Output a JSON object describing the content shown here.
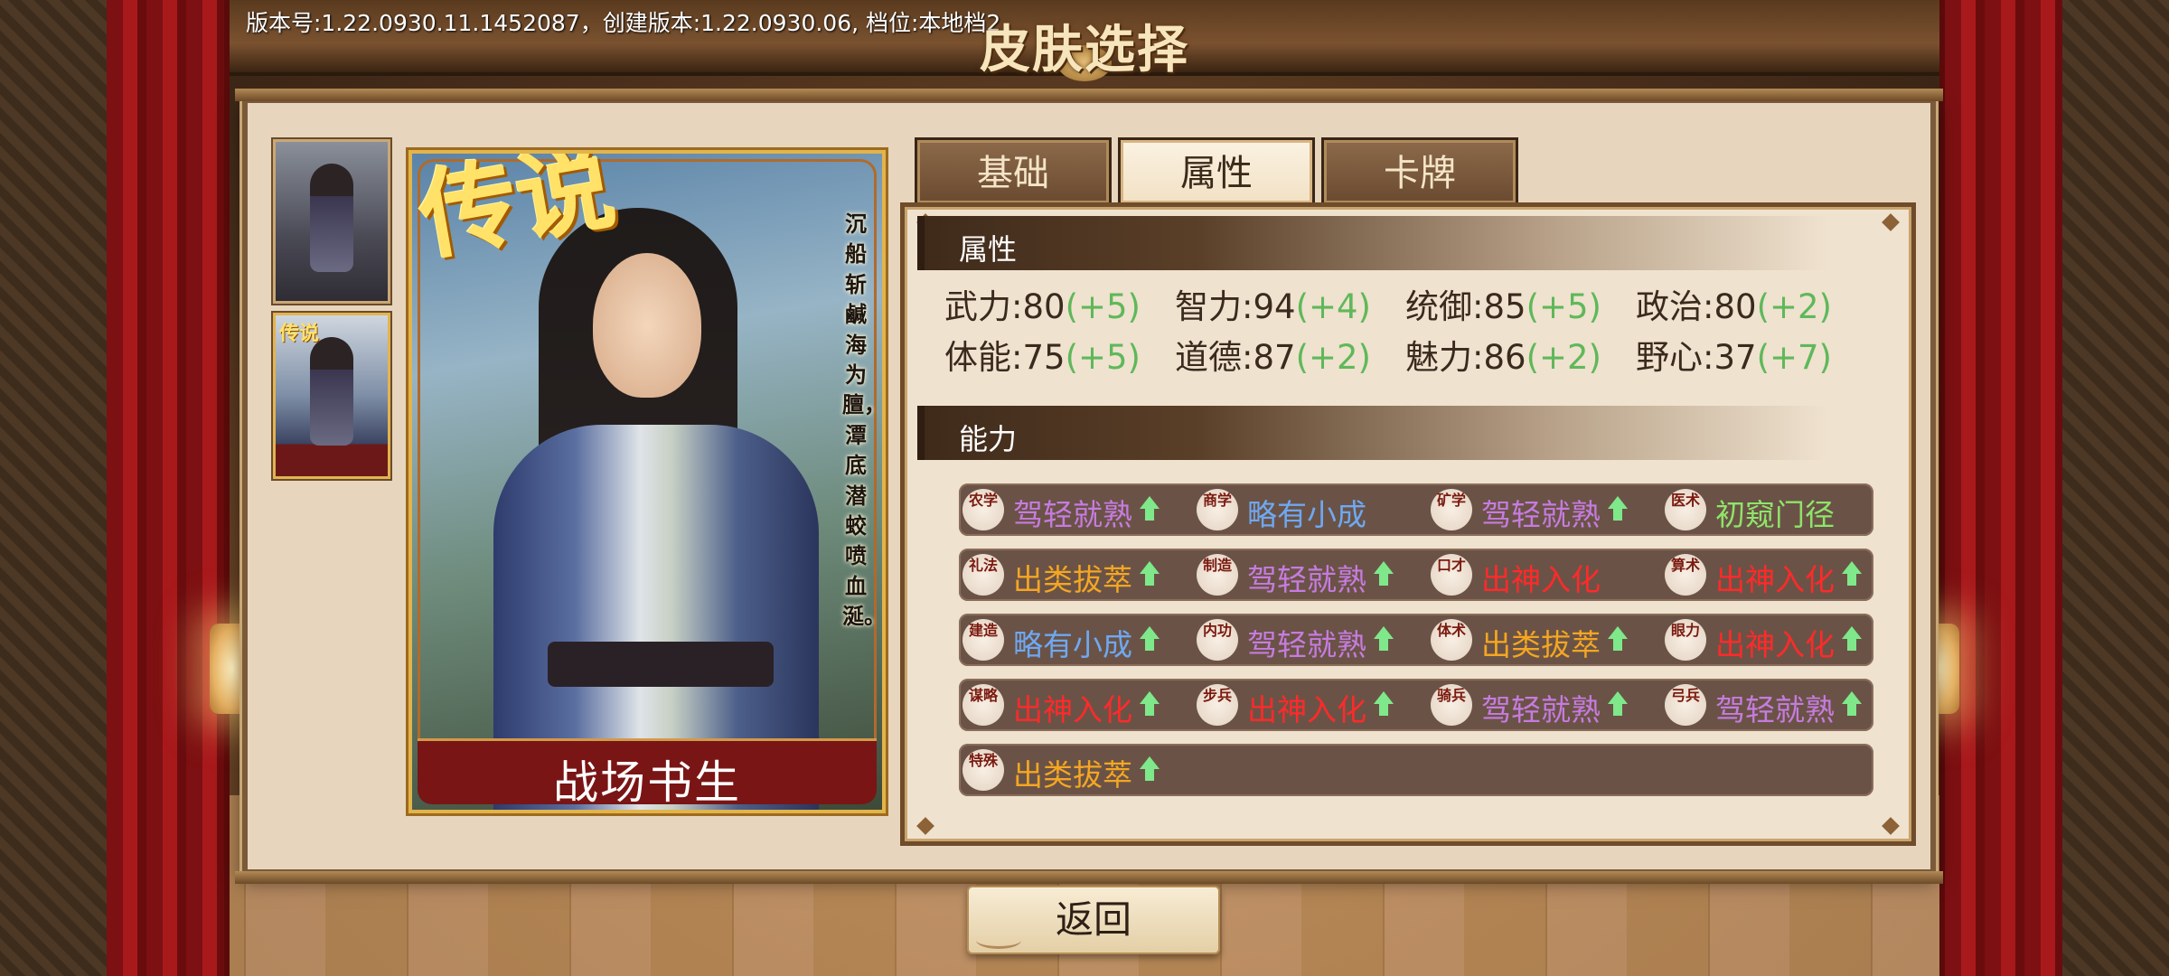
{
  "header": {
    "version_text": "版本号:1.22.0930.11.1452087，创建版本:1.22.0930.06, 档位:本地档2",
    "title": "皮肤选择"
  },
  "thumbnails": [
    {
      "name": "skin-default",
      "badge": ""
    },
    {
      "name": "skin-legend",
      "badge": "传说"
    }
  ],
  "card": {
    "badge": "传说",
    "poem": "沉船斩鹹海为膻，潭底潜蛟喷血涎。",
    "name": "战场书生"
  },
  "tabs": [
    {
      "label": "基础",
      "active": false
    },
    {
      "label": "属性",
      "active": true
    },
    {
      "label": "卡牌",
      "active": false
    }
  ],
  "attributes": {
    "section_title": "属性",
    "stats": [
      {
        "label": "武力:",
        "value": "80",
        "bonus": "(+5)"
      },
      {
        "label": "智力:",
        "value": "94",
        "bonus": "(+4)"
      },
      {
        "label": "统御:",
        "value": "85",
        "bonus": "(+5)"
      },
      {
        "label": "政治:",
        "value": "80",
        "bonus": "(+2)"
      },
      {
        "label": "体能:",
        "value": "75",
        "bonus": "(+5)"
      },
      {
        "label": "道德:",
        "value": "87",
        "bonus": "(+2)"
      },
      {
        "label": "魅力:",
        "value": "86",
        "bonus": "(+2)"
      },
      {
        "label": "野心:",
        "value": "37",
        "bonus": "(+7)"
      }
    ]
  },
  "abilities": {
    "section_title": "能力",
    "rows": [
      [
        {
          "icon": "农学",
          "level": "驾轻就熟",
          "color": "#c77be0",
          "up": true
        },
        {
          "icon": "商学",
          "level": "略有小成",
          "color": "#6fa8f2",
          "up": false
        },
        {
          "icon": "矿学",
          "level": "驾轻就熟",
          "color": "#c77be0",
          "up": true
        },
        {
          "icon": "医术",
          "level": "初窥门径",
          "color": "#8fe46a",
          "up": false
        }
      ],
      [
        {
          "icon": "礼法",
          "level": "出类拔萃",
          "color": "#f5a623",
          "up": true
        },
        {
          "icon": "制造",
          "level": "驾轻就熟",
          "color": "#c77be0",
          "up": true
        },
        {
          "icon": "口才",
          "level": "出神入化",
          "color": "#ff2a2a",
          "up": false
        },
        {
          "icon": "算术",
          "level": "出神入化",
          "color": "#ff2a2a",
          "up": true
        }
      ],
      [
        {
          "icon": "建造",
          "level": "略有小成",
          "color": "#6fa8f2",
          "up": true
        },
        {
          "icon": "内功",
          "level": "驾轻就熟",
          "color": "#c77be0",
          "up": true
        },
        {
          "icon": "体术",
          "level": "出类拔萃",
          "color": "#f5a623",
          "up": true
        },
        {
          "icon": "眼力",
          "level": "出神入化",
          "color": "#ff2a2a",
          "up": true
        }
      ],
      [
        {
          "icon": "谋略",
          "level": "出神入化",
          "color": "#ff2a2a",
          "up": true
        },
        {
          "icon": "步兵",
          "level": "出神入化",
          "color": "#ff2a2a",
          "up": true
        },
        {
          "icon": "骑兵",
          "level": "驾轻就熟",
          "color": "#c77be0",
          "up": true
        },
        {
          "icon": "弓兵",
          "level": "驾轻就熟",
          "color": "#c77be0",
          "up": true
        }
      ],
      [
        {
          "icon": "特殊",
          "level": "出类拔萃",
          "color": "#f5a623",
          "up": true
        }
      ]
    ]
  },
  "footer": {
    "back_label": "返回"
  }
}
